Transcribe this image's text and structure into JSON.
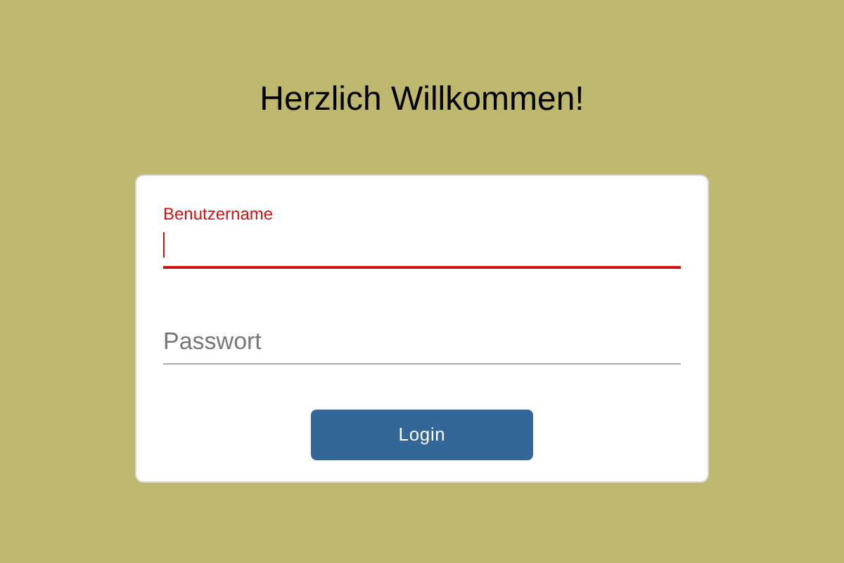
{
  "title": "Herzlich Willkommen!",
  "fields": [
    {
      "label": "Benutzername",
      "focused": true
    },
    {
      "placeholder": "Passwort",
      "focused": false
    }
  ],
  "button": "Login"
}
